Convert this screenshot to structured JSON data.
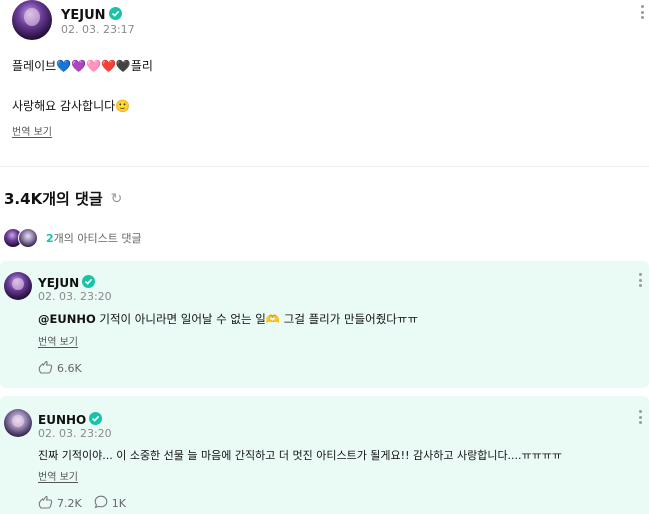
{
  "post": {
    "author": "YEJUN",
    "timestamp": "02. 03. 23:17",
    "line1": "플레이브💙💜🩷❤️🖤플리",
    "line2": "사랑해요 감사합니다🙂",
    "translate": "번역 보기"
  },
  "comments_header": {
    "title": "3.4K개의 댓글",
    "artist_count": "2",
    "artist_label": "개의 아티스트 댓글"
  },
  "comments": [
    {
      "author": "YEJUN",
      "timestamp": "02. 03. 23:20",
      "mention": "@EUNHO",
      "text": " 기적이 아니라면 일어날 수 없는 일🫶 그걸 플리가 만들어줬다ㅠㅠ",
      "translate": "번역 보기",
      "likes": "6.6K"
    },
    {
      "author": "EUNHO",
      "timestamp": "02. 03. 23:20",
      "text": "진짜 기적이야... 이 소중한 선물 늘 마음에 간직하고 더 멋진 아티스트가 될게요!! 감사하고 사랑합니다....ㅠㅠㅠㅠ",
      "translate": "번역 보기",
      "likes": "7.2K",
      "replies": "1K"
    }
  ],
  "colors": {
    "accent": "#19c3a8",
    "artist_comment_bg": "#eafbf6"
  }
}
